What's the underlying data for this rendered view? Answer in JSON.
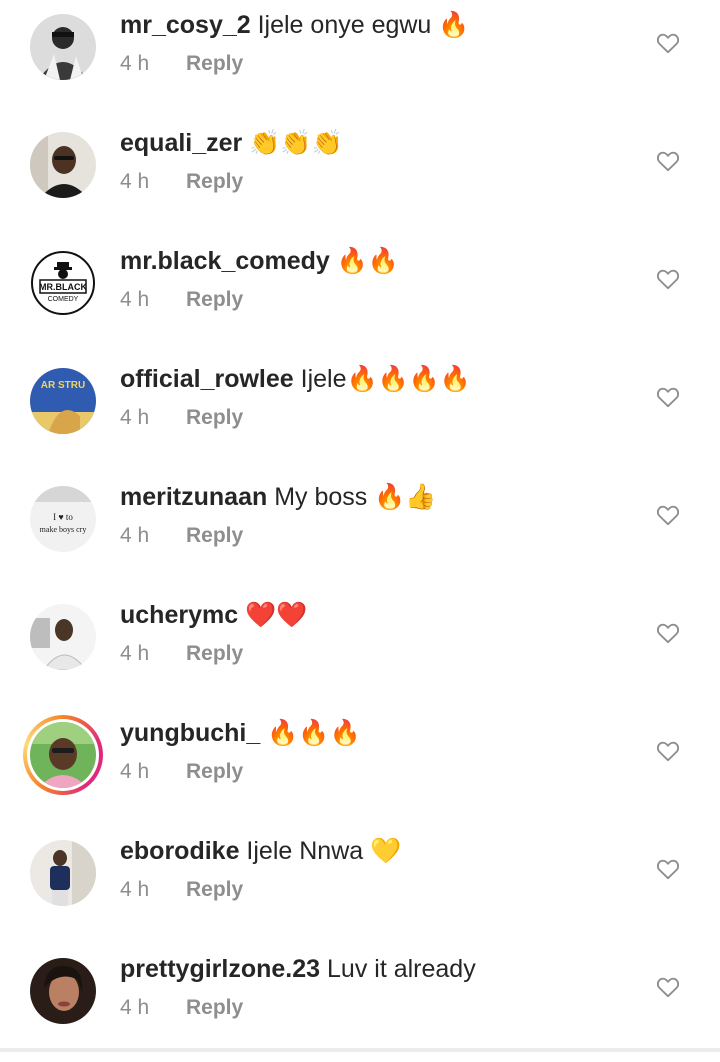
{
  "comments": [
    {
      "username": "mr_cosy_2",
      "text": " Ijele onye egwu 🔥",
      "time": "4 h",
      "reply": "Reply",
      "avatar_icon": "user-avatar-icon",
      "story_ring": false
    },
    {
      "username": "equali_zer",
      "text": " 👏👏👏",
      "time": "4 h",
      "reply": "Reply",
      "avatar_icon": "user-avatar-icon",
      "story_ring": false
    },
    {
      "username": "mr.black_comedy",
      "text": " 🔥🔥",
      "time": "4 h",
      "reply": "Reply",
      "avatar_icon": "user-avatar-icon",
      "story_ring": false
    },
    {
      "username": "official_rowlee",
      "text": " Ijele🔥🔥🔥🔥",
      "time": "4 h",
      "reply": "Reply",
      "avatar_icon": "user-avatar-icon",
      "story_ring": false
    },
    {
      "username": "meritzunaan",
      "text": " My boss 🔥👍",
      "time": "4 h",
      "reply": "Reply",
      "avatar_icon": "user-avatar-icon",
      "story_ring": false
    },
    {
      "username": "ucherymc",
      "text": " ❤️❤️",
      "time": "4 h",
      "reply": "Reply",
      "avatar_icon": "user-avatar-icon",
      "story_ring": false
    },
    {
      "username": "yungbuchi_",
      "text": " 🔥🔥🔥",
      "time": "4 h",
      "reply": "Reply",
      "avatar_icon": "user-avatar-icon",
      "story_ring": true
    },
    {
      "username": "eborodike",
      "text": " Ijele Nnwa 💛",
      "time": "4 h",
      "reply": "Reply",
      "avatar_icon": "user-avatar-icon",
      "story_ring": false
    },
    {
      "username": "prettygirlzone.23",
      "text": " Luv it already",
      "time": "4 h",
      "reply": "Reply",
      "avatar_icon": "user-avatar-icon",
      "story_ring": false
    }
  ],
  "avatar_logo_text": {
    "mr_black_comedy": "MR.BLACK",
    "mr_black_comedy_sub": "COMEDY",
    "official_rowlee": "AR STRU",
    "meritzunaan_line1": "I ♥ to",
    "meritzunaan_line2": "make boys cry"
  },
  "colors": {
    "username": "#262626",
    "meta": "#8e8e8e",
    "like_icon": "#8e8e8e",
    "story_ring_start": "#f58529",
    "story_ring_end": "#dd2a7b"
  },
  "icons": {
    "like": "heart-outline-icon"
  }
}
